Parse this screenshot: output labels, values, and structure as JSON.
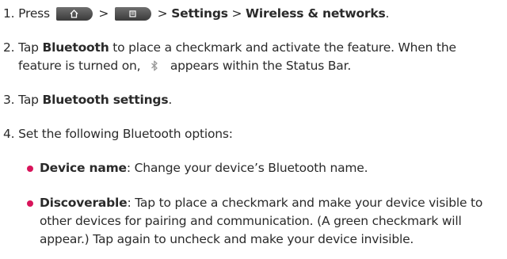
{
  "steps": [
    {
      "num": "1.",
      "press": "Press",
      "sep1": ">",
      "sep2": ">",
      "settings": "Settings",
      "sep3": ">",
      "wireless": "Wireless & networks",
      "end": "."
    },
    {
      "num": "2.",
      "tap": "Tap",
      "bluetooth": "Bluetooth",
      "rest1": "to place a checkmark and activate the feature. When the",
      "rest2a": "feature is turned on,",
      "rest2b": "appears within the Status Bar."
    },
    {
      "num": "3.",
      "tap": "Tap",
      "bt_settings": "Bluetooth settings",
      "end": "."
    },
    {
      "num": "4.",
      "text": "Set the following Bluetooth options:"
    }
  ],
  "bullets": [
    {
      "term": "Device name",
      "line1": ": Change your device’s Bluetooth name."
    },
    {
      "term": "Discoverable",
      "line1": ": Tap to place a checkmark and make your device visible to",
      "line2": "other devices for pairing and communication. (A green checkmark will",
      "line3": "appear.) Tap again to uncheck and make your device invisible."
    }
  ],
  "icons": {
    "home_key": "home-icon",
    "menu_key": "menu-icon",
    "status_icon": "bluetooth-icon"
  },
  "colors": {
    "bullet": "#d8145a",
    "text": "#2a2a2a"
  }
}
